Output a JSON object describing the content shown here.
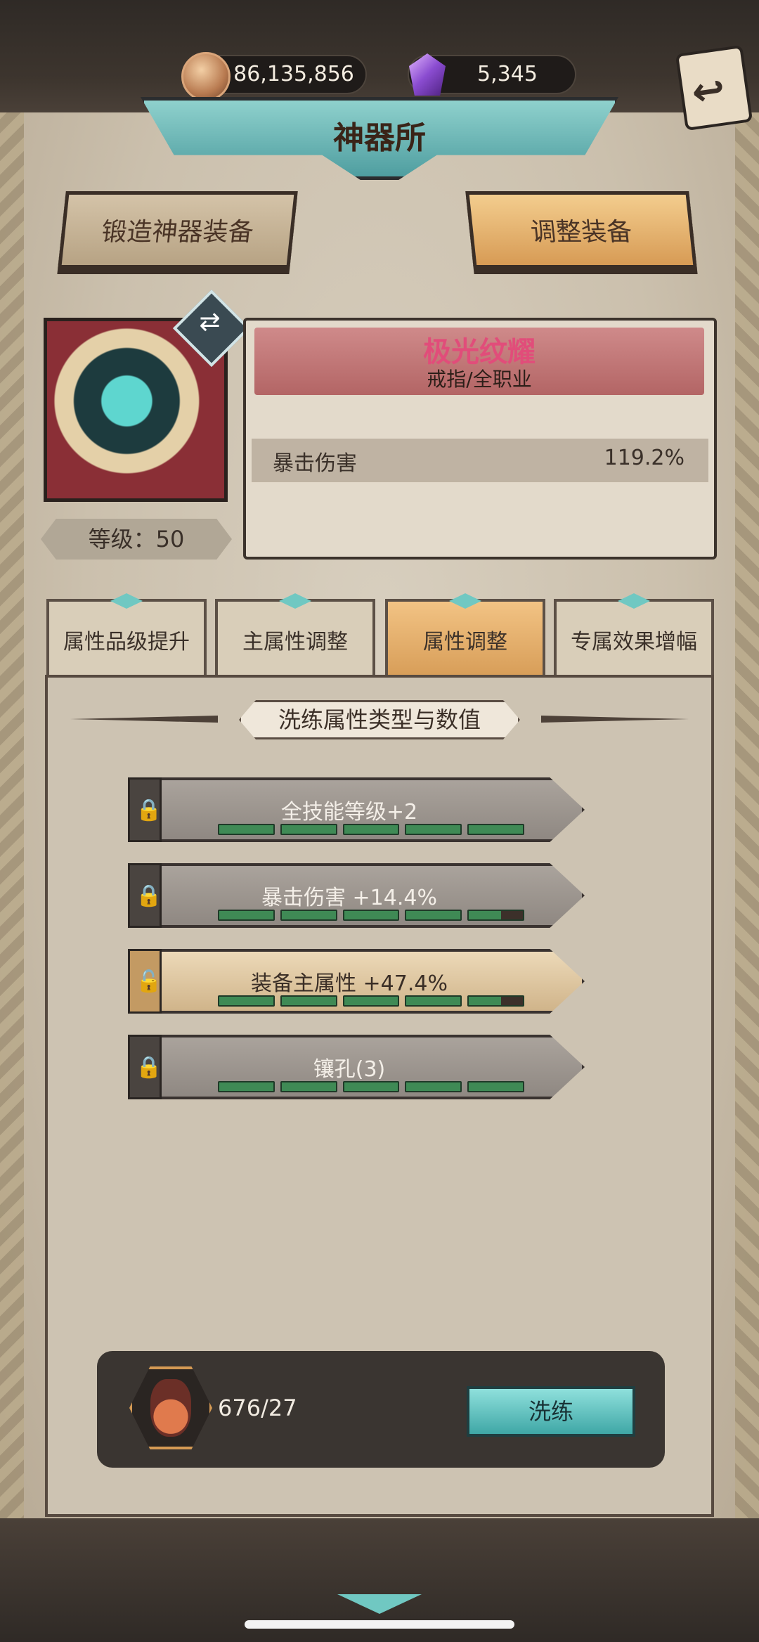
{
  "currency": {
    "coins": "86,135,856",
    "gems": "5,345"
  },
  "title": "神器所",
  "top_tabs": {
    "forge": "锻造神器装备",
    "adjust": "调整装备"
  },
  "item": {
    "name": "极光纹耀",
    "type": "戒指/全职业",
    "level": "等级：50",
    "stat_label": "暴击伤害",
    "stat_value": "119.2%"
  },
  "sub_tabs": [
    "属性品级提升",
    "主属性调整",
    "属性调整",
    "专属效果增幅"
  ],
  "active_sub_tab": 2,
  "section_title": "洗练属性类型与数值",
  "attributes": [
    {
      "label": "全技能等级+2",
      "locked": true,
      "filled": 5
    },
    {
      "label": "暴击伤害 +14.4%",
      "locked": true,
      "filled": 4.6
    },
    {
      "label": "装备主属性 +47.4%",
      "locked": false,
      "filled": 4.5
    },
    {
      "label": "镶孔(3)",
      "locked": true,
      "filled": 5
    }
  ],
  "cost": "676/27",
  "wash_button": "洗练",
  "icons": {
    "coin": "coin-icon",
    "gem": "gem-icon",
    "back": "back-arrow-icon",
    "lock": "lock-icon",
    "unlock": "unlock-icon",
    "potion": "potion-icon",
    "swap": "swap-icon"
  },
  "colors": {
    "accent_teal": "#70c8c2",
    "active_tab": "#d59a54",
    "item_name": "#e14d7a",
    "progress_green": "#3f8a55"
  }
}
